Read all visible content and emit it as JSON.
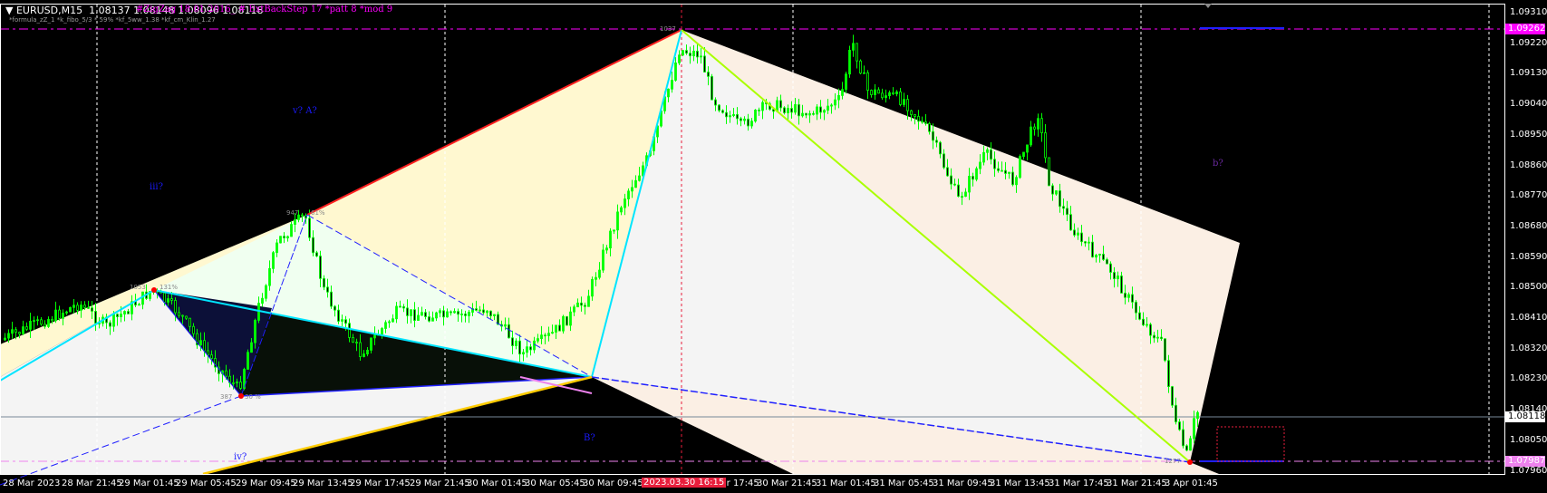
{
  "header": {
    "menu_icon": "triangle-down-icon",
    "symbol": "EURUSD,M15",
    "ohlc": "1.08137 1.08148 1.08096 1.08118",
    "indicator_info": "#ZigZag 18.01.2016_  # ExtBackStep 17  *patt 8  *mod 9",
    "params": "*formula_zZ_1  *k_fibo_5/3 * 59%  *kf_5ww_1.38  *kf_cm_Klin_1.27"
  },
  "price_axis": [
    "1.09310",
    "1.09220",
    "1.09130",
    "1.09040",
    "1.08950",
    "1.08860",
    "1.08770",
    "1.08680",
    "1.08590",
    "1.08500",
    "1.08410",
    "1.08320",
    "1.08230",
    "1.08140",
    "1.08050",
    "1.07960"
  ],
  "price_tags": {
    "high_level": "1.09262",
    "current": "1.08118",
    "low_level": "1.07987"
  },
  "time_axis": [
    "28 Mar 2023",
    "28 Mar 21:45",
    "29 Mar 01:45",
    "29 Mar 05:45",
    "29 Mar 09:45",
    "29 Mar 13:45",
    "29 Mar 17:45",
    "29 Mar 21:45",
    "30 Mar 01:45",
    "30 Mar 05:45",
    "30 Mar 09:45",
    "30 Mar 17:45",
    "30 Mar 21:45",
    "31 Mar 01:45",
    "31 Mar 05:45",
    "31 Mar 09:45",
    "31 Mar 13:45",
    "31 Mar 17:45",
    "31 Mar 21:45",
    "3 Apr 01:45"
  ],
  "crosshair_time": "2023.03.30 16:15",
  "wave_labels": {
    "iii": "iii?",
    "v_a": "v? A?",
    "iv": "iv?",
    "B": "B?",
    "b": "b?"
  },
  "pivot_labels": {
    "a_num": "1053",
    "a_pct": "131%",
    "b_num": "947",
    "b_pct": "61%",
    "low_num": "387",
    "low_pct": "30 %",
    "peak_num": "1037",
    "last_num": "1277"
  },
  "colors": {
    "bull": "#00ff00",
    "magenta": "#ff00ff",
    "accent_red": "#e81e3c"
  }
}
